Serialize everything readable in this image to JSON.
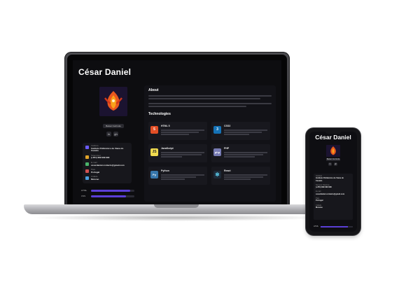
{
  "laptop_site": {
    "title": "César Daniel",
    "cv_button": "Baixar Currículo",
    "social": [
      "in",
      "gh"
    ],
    "info": [
      {
        "label": "Instituto",
        "value": "Instituto Politécnico de Viana do Castelo"
      },
      {
        "label": "Telemóvel",
        "value": "(+351) 999 999 999"
      },
      {
        "label": "E-mail",
        "value": "cesardaniel.contacto@gmail.com"
      },
      {
        "label": "País",
        "value": "Portugal"
      },
      {
        "label": "Cidade",
        "value": "Moncao"
      }
    ],
    "skills": [
      {
        "label": "HTML",
        "level": 0.9
      },
      {
        "label": "CSS",
        "level": 0.8
      }
    ],
    "about_title": "About",
    "tech_title": "Technologies",
    "technologies": [
      {
        "name": "HTML 5",
        "icon": "html5-icon",
        "color": "#e34f26",
        "glyph": "5"
      },
      {
        "name": "CSS3",
        "icon": "css3-icon",
        "color": "#1572b6",
        "glyph": "3"
      },
      {
        "name": "JavaScript",
        "icon": "javascript-icon",
        "color": "#f0db4f",
        "glyph": "JS"
      },
      {
        "name": "PHP",
        "icon": "php-icon",
        "color": "#777bb3",
        "glyph": "php"
      },
      {
        "name": "Python",
        "icon": "python-icon",
        "color": "#3776ab",
        "glyph": "Py"
      },
      {
        "name": "React",
        "icon": "react-icon",
        "color": "#61dafb",
        "glyph": "⚛"
      }
    ]
  },
  "phone_site": {
    "title": "César Daniel",
    "cv_button": "Baixar Currículo",
    "info": [
      {
        "label": "Instituto",
        "value": "Instituto Politécnico de Viana do Castelo"
      },
      {
        "label": "Número Telefone",
        "value": "(+351) 999 999 999"
      },
      {
        "label": "E-mail",
        "value": "cesardaniel.contacto@gmail.com"
      },
      {
        "label": "País",
        "value": "Portugal"
      },
      {
        "label": "Cidade",
        "value": "Moncao"
      }
    ],
    "skill": {
      "label": "HTML",
      "level": 0.85
    }
  },
  "colors": {
    "accent": "#5b3fd6",
    "site_bg": "#0d0d10",
    "card_bg": "#17171c"
  }
}
